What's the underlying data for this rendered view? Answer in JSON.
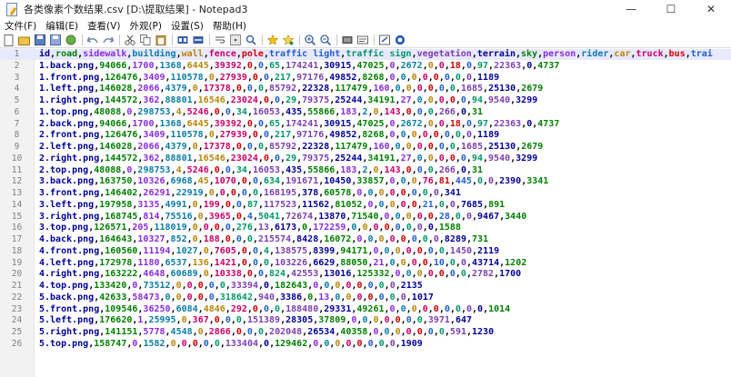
{
  "window": {
    "title": "各类像素个数结果.csv [D:\\提取结果] - Notepad3",
    "minimize_label": "—",
    "maximize_label": "☐",
    "close_label": "✕"
  },
  "menu": [
    "文件(F)",
    "编辑(E)",
    "查看(V)",
    "外观(P)",
    "设置(S)",
    "帮助(H)"
  ],
  "toolbar": {
    "icons": [
      "new-file-icon",
      "open-file-icon",
      "save-icon",
      "save-as-icon",
      "browse-icon",
      "undo-icon",
      "redo-icon",
      "cut-icon",
      "copy-icon",
      "paste-icon",
      "find-icon",
      "replace-icon",
      "word-wrap-icon",
      "view-whitespace-icon",
      "view-eol-icon",
      "print-icon",
      "find-in-files-icon",
      "add-favorite-icon",
      "favorites-icon",
      "zoom-in-icon",
      "zoom-out-icon",
      "schema-icon",
      "schema-config-icon",
      "export-icon",
      "about-icon"
    ]
  },
  "lines": [
    "id,road,sidewalk,building,wall,fence,pole,traffic light,traffic sign,vegetation,terrain,sky,person,rider,car,truck,bus,trai",
    "1.back.png,94066,1700,1368,6445,39392,0,0,65,174241,30915,47025,0,2672,0,0,18,0,97,22363,0,4737",
    "1.front.png,126476,3409,110578,0,27939,0,0,217,97176,49852,8268,0,0,0,0,0,0,0,0,1189",
    "1.left.png,146028,2066,4379,0,17378,0,0,0,85792,22328,117479,160,0,0,0,0,0,0,1685,25130,2679",
    "1.right.png,144572,362,88801,16546,23024,0,0,29,79375,25244,34191,27,0,0,0,0,0,94,9540,3299",
    "1.top.png,48088,0,298753,4,5246,0,0,34,16053,435,55866,183,2,0,143,0,0,0,266,0,31",
    "2.back.png,94066,1700,1368,6445,39392,0,0,65,174241,30915,47025,0,2672,0,0,18,0,97,22363,0,4737",
    "2.front.png,126476,3409,110578,0,27939,0,0,217,97176,49852,8268,0,0,0,0,0,0,0,0,1189",
    "2.left.png,146028,2066,4379,0,17378,0,0,0,85792,22328,117479,160,0,0,0,0,0,0,1685,25130,2679",
    "2.right.png,144572,362,88801,16546,23024,0,0,29,79375,25244,34191,27,0,0,0,0,0,94,9540,3299",
    "2.top.png,48088,0,298753,4,5246,0,0,34,16053,435,55866,183,2,0,143,0,0,0,266,0,31",
    "3.back.png,163750,10326,6968,45,1070,0,0,634,191671,10450,33857,0,0,0,76,81,445,0,0,2390,3341",
    "3.front.png,146402,26291,22919,0,0,0,0,0,168195,378,60578,0,0,0,0,0,0,0,0,341",
    "3.left.png,197958,3135,4991,0,199,0,0,87,117523,11562,81052,0,0,0,0,0,21,0,0,7685,891",
    "3.right.png,168745,814,75516,0,3965,0,4,5041,72674,13870,71540,0,0,0,0,0,28,0,0,9467,3440",
    "3.top.png,126571,205,118019,0,0,0,0,276,13,6173,0,172259,0,0,0,0,0,0,0,0,1588",
    "4.back.png,164643,10327,852,0,188,0,0,0,215574,8428,16072,0,0,0,0,0,0,0,0,8289,731",
    "4.front.png,160560,11194,1027,0,7605,0,0,4,138575,8399,94171,0,0,0,0,0,0,0,1450,2119",
    "4.left.png,172978,1180,6537,136,1421,0,0,0,103226,6629,88050,21,0,0,0,0,10,0,0,43714,1202",
    "4.right.png,163222,4648,60689,0,10338,0,0,824,42553,13016,125332,0,0,0,0,0,0,0,2782,1700",
    "4.top.png,133420,0,73512,0,0,0,0,0,33394,0,182643,0,0,0,0,0,0,0,0,2135",
    "5.back.png,42633,58473,0,0,0,0,0,318642,940,3386,0,13,0,0,0,0,0,0,0,1017",
    "5.front.png,109546,36250,6084,4846,292,0,0,0,188480,29331,49261,0,0,0,0,0,0,0,0,0,1014",
    "5.left.png,176620,1,25995,0,367,0,0,0,151389,28305,37809,0,0,0,0,0,0,0,3971,647",
    "5.right.png,141151,5778,4548,0,2866,0,0,0,202048,26534,40358,0,0,0,0,0,0,0,591,1230",
    "5.top.png,158747,0,1582,0,0,0,0,0,133404,0,129462,0,0,0,0,0,0,0,0,1909"
  ]
}
